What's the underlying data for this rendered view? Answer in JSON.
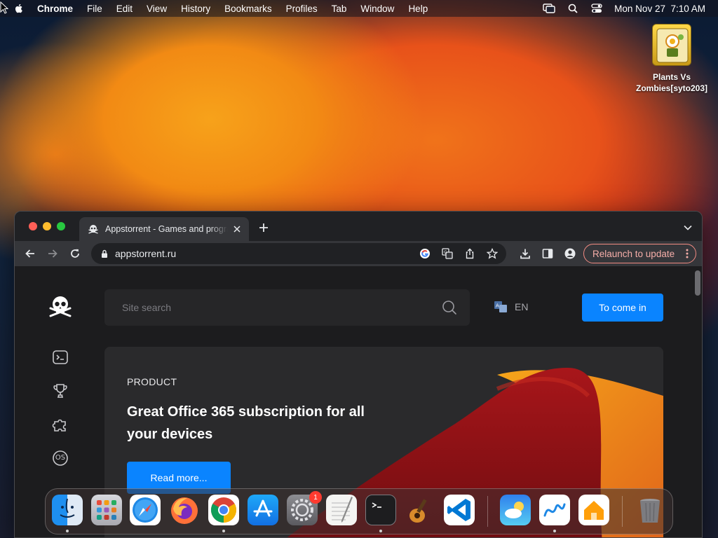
{
  "menubar": {
    "app_name": "Chrome",
    "items": [
      "File",
      "Edit",
      "View",
      "History",
      "Bookmarks",
      "Profiles",
      "Tab",
      "Window",
      "Help"
    ],
    "datetime": "Mon Nov 27  7:10 AM"
  },
  "desktop": {
    "icons": [
      {
        "label_line1": "Plants Vs",
        "label_line2": "Zombies[syto203]"
      }
    ]
  },
  "browser": {
    "tab_title": "Appstorrent - Games and programs",
    "url": "appstorrent.ru",
    "relaunch_label": "Relaunch to update"
  },
  "site": {
    "search_placeholder": "Site search",
    "language": "EN",
    "login_label": "To come in",
    "sidebar_icons": [
      "terminal-icon",
      "trophy-icon",
      "puzzle-icon",
      "os-icon"
    ],
    "os_label": "OS",
    "hero": {
      "kicker": "PRODUCT",
      "headline": "Great Office 365 subscription for all your devices",
      "cta_label": "Read more..."
    }
  },
  "dock": {
    "apps": [
      "finder",
      "launchpad",
      "safari",
      "firefox",
      "chrome",
      "app-store",
      "system-settings",
      "textedit",
      "terminal",
      "garageband",
      "vscode",
      "weather",
      "freeform",
      "home",
      "trash"
    ],
    "system_settings_badge": "1"
  },
  "colors": {
    "accent": "#0a84ff",
    "relaunch": "#f28b82",
    "page_bg": "#1c1c1e"
  }
}
